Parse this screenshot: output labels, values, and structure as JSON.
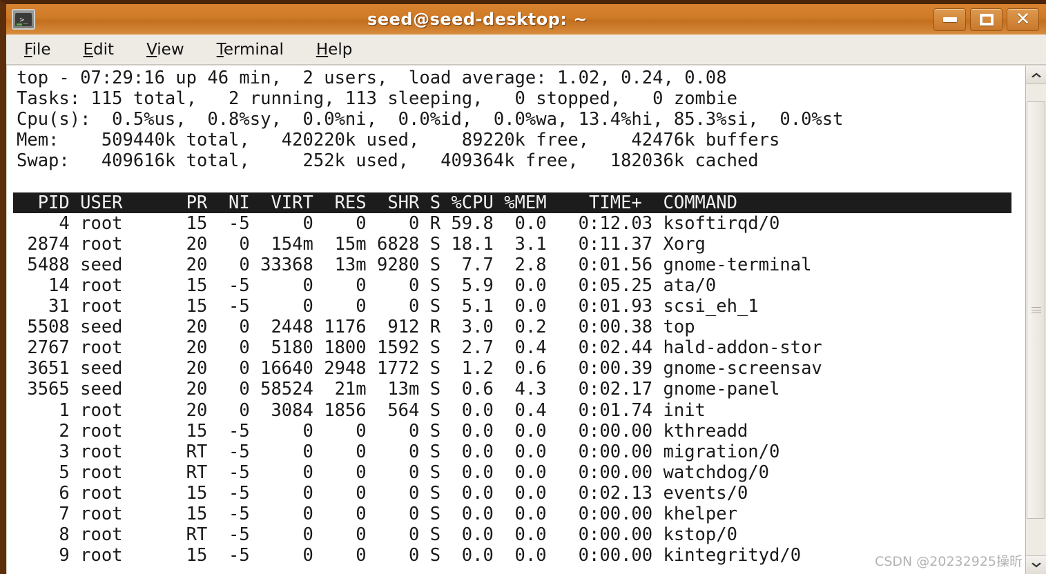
{
  "window": {
    "title": "seed@seed-desktop: ~",
    "icon": "terminal-icon",
    "accent_color": "#cf7a26",
    "controls": [
      {
        "name": "minimize",
        "label": "_"
      },
      {
        "name": "maximize",
        "label": "□"
      },
      {
        "name": "close",
        "label": "✕"
      }
    ]
  },
  "menubar": {
    "items": [
      {
        "label": "File",
        "mnemonic": "F"
      },
      {
        "label": "Edit",
        "mnemonic": "E"
      },
      {
        "label": "View",
        "mnemonic": "V"
      },
      {
        "label": "Terminal",
        "mnemonic": "T"
      },
      {
        "label": "Help",
        "mnemonic": "H"
      }
    ]
  },
  "terminal": {
    "summary": {
      "line1": "top - 07:29:16 up 46 min,  2 users,  load average: 1.02, 0.24, 0.08",
      "line2": "Tasks: 115 total,   2 running, 113 sleeping,   0 stopped,   0 zombie",
      "line3": "Cpu(s):  0.5%us,  0.8%sy,  0.0%ni,  0.0%id,  0.0%wa, 13.4%hi, 85.3%si,  0.0%st",
      "line4": "Mem:    509440k total,   420220k used,    89220k free,    42476k buffers",
      "line5": "Swap:   409616k total,     252k used,   409364k free,   182036k cached",
      "uptime": "46 min",
      "time": "07:29:16",
      "users": "2",
      "load_average": [
        1.02,
        0.24,
        0.08
      ],
      "tasks": {
        "total": 115,
        "running": 2,
        "sleeping": 113,
        "stopped": 0,
        "zombie": 0
      },
      "cpu": {
        "us": "0.5",
        "sy": "0.8",
        "ni": "0.0",
        "id": "0.0",
        "wa": "0.0",
        "hi": "13.4",
        "si": "85.3",
        "st": "0.0"
      },
      "mem": {
        "total": "509440k",
        "used": "420220k",
        "free": "89220k",
        "buffers": "42476k"
      },
      "swap": {
        "total": "409616k",
        "used": "252k",
        "free": "409364k",
        "cached": "182036k"
      }
    },
    "header_row": "  PID USER      PR  NI  VIRT  RES  SHR S %CPU %MEM    TIME+  COMMAND",
    "columns": [
      "PID",
      "USER",
      "PR",
      "NI",
      "VIRT",
      "RES",
      "SHR",
      "S",
      "%CPU",
      "%MEM",
      "TIME+",
      "COMMAND"
    ],
    "rows": [
      "    4 root      15  -5     0    0    0 R 59.8  0.0   0:12.03 ksoftirqd/0",
      " 2874 root      20   0  154m  15m 6828 S 18.1  3.1   0:11.37 Xorg",
      " 5488 seed      20   0 33368  13m 9280 S  7.7  2.8   0:01.56 gnome-terminal",
      "   14 root      15  -5     0    0    0 S  5.9  0.0   0:05.25 ata/0",
      "   31 root      15  -5     0    0    0 S  5.1  0.0   0:01.93 scsi_eh_1",
      " 5508 seed      20   0  2448 1176  912 R  3.0  0.2   0:00.38 top",
      " 2767 root      20   0  5180 1800 1592 S  2.7  0.4   0:02.44 hald-addon-stor",
      " 3651 seed      20   0 16640 2948 1772 S  1.2  0.6   0:00.39 gnome-screensav",
      " 3565 seed      20   0 58524  21m  13m S  0.6  4.3   0:02.17 gnome-panel",
      "    1 root      20   0  3084 1856  564 S  0.0  0.4   0:01.74 init",
      "    2 root      15  -5     0    0    0 S  0.0  0.0   0:00.00 kthreadd",
      "    3 root      RT  -5     0    0    0 S  0.0  0.0   0:00.00 migration/0",
      "    5 root      RT  -5     0    0    0 S  0.0  0.0   0:00.00 watchdog/0",
      "    6 root      15  -5     0    0    0 S  0.0  0.0   0:02.13 events/0",
      "    7 root      15  -5     0    0    0 S  0.0  0.0   0:00.00 khelper",
      "    8 root      RT  -5     0    0    0 S  0.0  0.0   0:00.00 kstop/0",
      "    9 root      15  -5     0    0    0 S  0.0  0.0   0:00.00 kintegrityd/0"
    ],
    "processes": [
      {
        "pid": "4",
        "user": "root",
        "pr": "15",
        "ni": "-5",
        "virt": "0",
        "res": "0",
        "shr": "0",
        "s": "R",
        "cpu": "59.8",
        "mem": "0.0",
        "time": "0:12.03",
        "command": "ksoftirqd/0"
      },
      {
        "pid": "2874",
        "user": "root",
        "pr": "20",
        "ni": "0",
        "virt": "154m",
        "res": "15m",
        "shr": "6828",
        "s": "S",
        "cpu": "18.1",
        "mem": "3.1",
        "time": "0:11.37",
        "command": "Xorg"
      },
      {
        "pid": "5488",
        "user": "seed",
        "pr": "20",
        "ni": "0",
        "virt": "33368",
        "res": "13m",
        "shr": "9280",
        "s": "S",
        "cpu": "7.7",
        "mem": "2.8",
        "time": "0:01.56",
        "command": "gnome-terminal"
      },
      {
        "pid": "14",
        "user": "root",
        "pr": "15",
        "ni": "-5",
        "virt": "0",
        "res": "0",
        "shr": "0",
        "s": "S",
        "cpu": "5.9",
        "mem": "0.0",
        "time": "0:05.25",
        "command": "ata/0"
      },
      {
        "pid": "31",
        "user": "root",
        "pr": "15",
        "ni": "-5",
        "virt": "0",
        "res": "0",
        "shr": "0",
        "s": "S",
        "cpu": "5.1",
        "mem": "0.0",
        "time": "0:01.93",
        "command": "scsi_eh_1"
      },
      {
        "pid": "5508",
        "user": "seed",
        "pr": "20",
        "ni": "0",
        "virt": "2448",
        "res": "1176",
        "shr": "912",
        "s": "R",
        "cpu": "3.0",
        "mem": "0.2",
        "time": "0:00.38",
        "command": "top"
      },
      {
        "pid": "2767",
        "user": "root",
        "pr": "20",
        "ni": "0",
        "virt": "5180",
        "res": "1800",
        "shr": "1592",
        "s": "S",
        "cpu": "2.7",
        "mem": "0.4",
        "time": "0:02.44",
        "command": "hald-addon-stor"
      },
      {
        "pid": "3651",
        "user": "seed",
        "pr": "20",
        "ni": "0",
        "virt": "16640",
        "res": "2948",
        "shr": "1772",
        "s": "S",
        "cpu": "1.2",
        "mem": "0.6",
        "time": "0:00.39",
        "command": "gnome-screensav"
      },
      {
        "pid": "3565",
        "user": "seed",
        "pr": "20",
        "ni": "0",
        "virt": "58524",
        "res": "21m",
        "shr": "13m",
        "s": "S",
        "cpu": "0.6",
        "mem": "4.3",
        "time": "0:02.17",
        "command": "gnome-panel"
      },
      {
        "pid": "1",
        "user": "root",
        "pr": "20",
        "ni": "0",
        "virt": "3084",
        "res": "1856",
        "shr": "564",
        "s": "S",
        "cpu": "0.0",
        "mem": "0.4",
        "time": "0:01.74",
        "command": "init"
      },
      {
        "pid": "2",
        "user": "root",
        "pr": "15",
        "ni": "-5",
        "virt": "0",
        "res": "0",
        "shr": "0",
        "s": "S",
        "cpu": "0.0",
        "mem": "0.0",
        "time": "0:00.00",
        "command": "kthreadd"
      },
      {
        "pid": "3",
        "user": "root",
        "pr": "RT",
        "ni": "-5",
        "virt": "0",
        "res": "0",
        "shr": "0",
        "s": "S",
        "cpu": "0.0",
        "mem": "0.0",
        "time": "0:00.00",
        "command": "migration/0"
      },
      {
        "pid": "5",
        "user": "root",
        "pr": "RT",
        "ni": "-5",
        "virt": "0",
        "res": "0",
        "shr": "0",
        "s": "S",
        "cpu": "0.0",
        "mem": "0.0",
        "time": "0:00.00",
        "command": "watchdog/0"
      },
      {
        "pid": "6",
        "user": "root",
        "pr": "15",
        "ni": "-5",
        "virt": "0",
        "res": "0",
        "shr": "0",
        "s": "S",
        "cpu": "0.0",
        "mem": "0.0",
        "time": "0:02.13",
        "command": "events/0"
      },
      {
        "pid": "7",
        "user": "root",
        "pr": "15",
        "ni": "-5",
        "virt": "0",
        "res": "0",
        "shr": "0",
        "s": "S",
        "cpu": "0.0",
        "mem": "0.0",
        "time": "0:00.00",
        "command": "khelper"
      },
      {
        "pid": "8",
        "user": "root",
        "pr": "RT",
        "ni": "-5",
        "virt": "0",
        "res": "0",
        "shr": "0",
        "s": "S",
        "cpu": "0.0",
        "mem": "0.0",
        "time": "0:00.00",
        "command": "kstop/0"
      },
      {
        "pid": "9",
        "user": "root",
        "pr": "15",
        "ni": "-5",
        "virt": "0",
        "res": "0",
        "shr": "0",
        "s": "S",
        "cpu": "0.0",
        "mem": "0.0",
        "time": "0:00.00",
        "command": "kintegrityd/0"
      }
    ]
  },
  "scrollbar": {
    "up_arrow": "chevron-up-icon",
    "down_arrow": "chevron-down-icon"
  },
  "watermark": {
    "text": "CSDN @20232925操昕"
  }
}
